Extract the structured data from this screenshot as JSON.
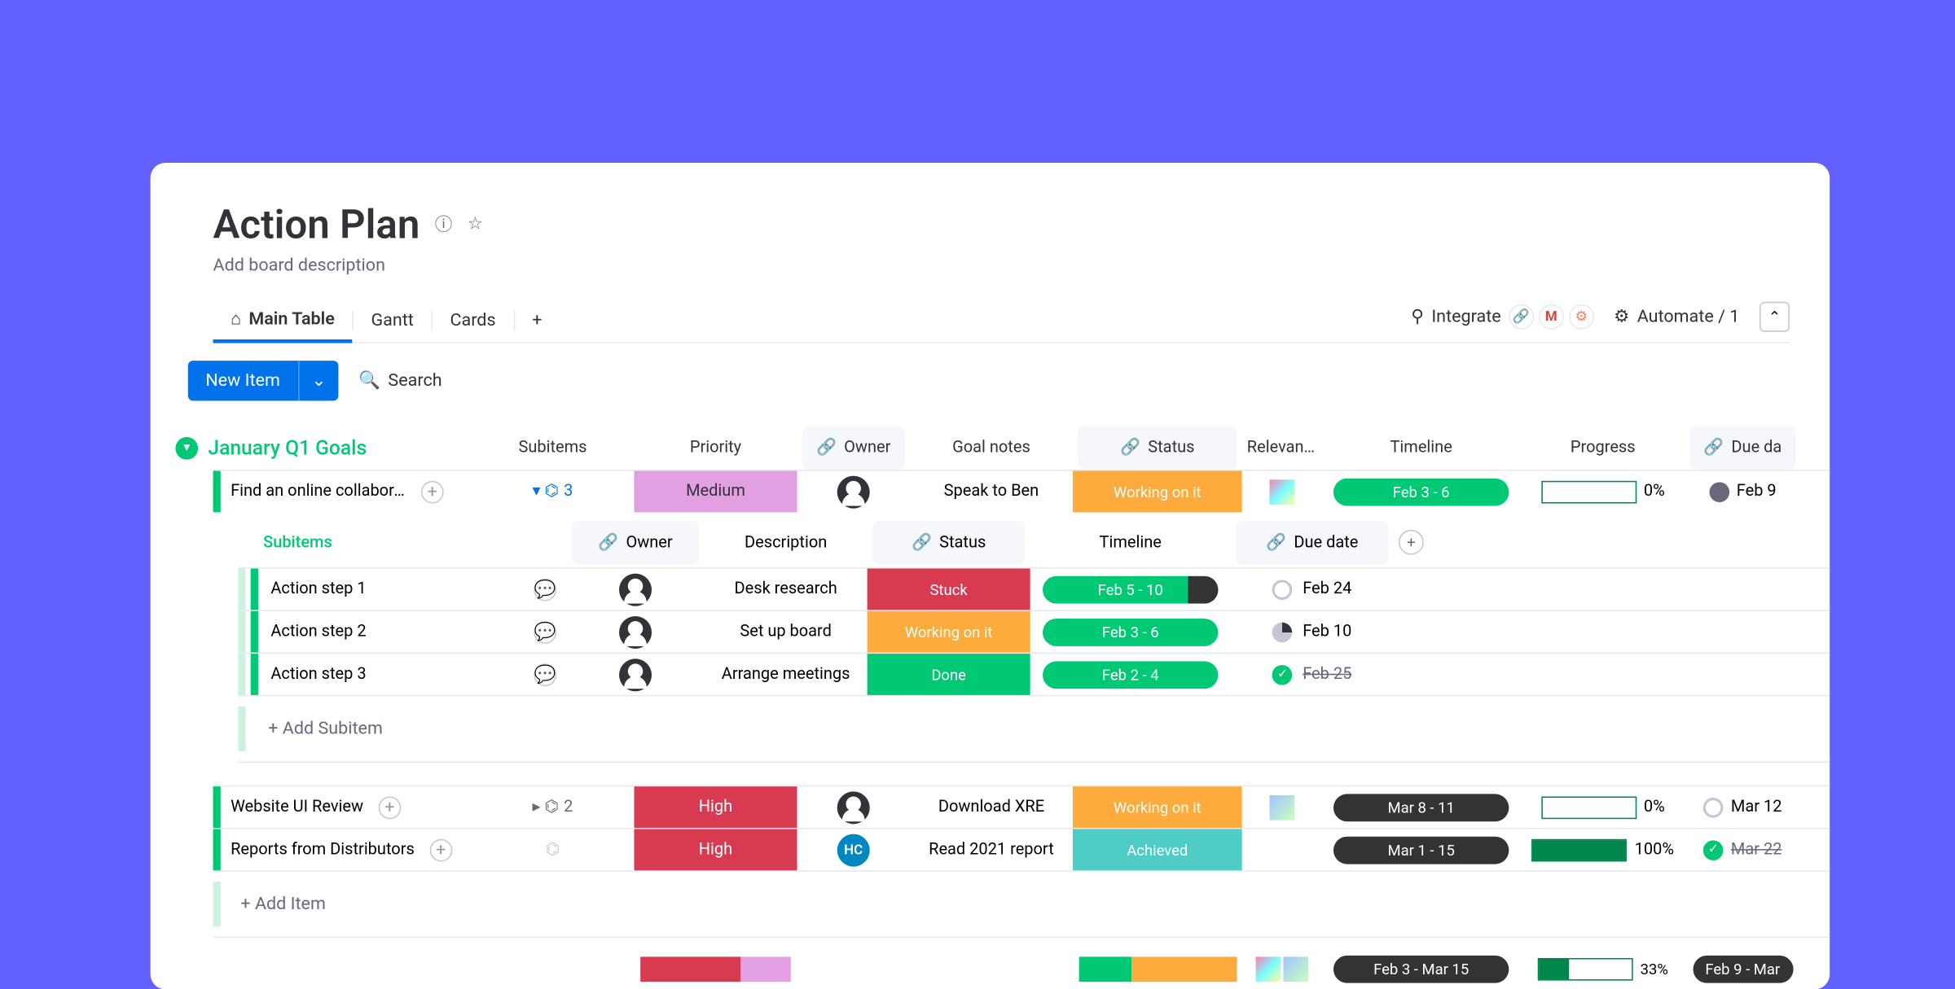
{
  "board": {
    "title": "Action Plan",
    "subtitle": "Add board description"
  },
  "tabs": {
    "main": "Main Table",
    "gantt": "Gantt",
    "cards": "Cards"
  },
  "actions": {
    "integrate": "Integrate",
    "automate": "Automate / 1",
    "new_item": "New Item",
    "search": "Search"
  },
  "group": {
    "name": "January Q1 Goals",
    "columns": {
      "subitems": "Subitems",
      "priority": "Priority",
      "owner": "Owner",
      "goal_notes": "Goal notes",
      "status": "Status",
      "relevant": "Relevant F…",
      "timeline": "Timeline",
      "progress": "Progress",
      "due": "Due da"
    }
  },
  "rows": [
    {
      "name": "Find an online collaborat…",
      "sub_count": "3",
      "priority": "Medium",
      "priority_class": "prio-med",
      "notes": "Speak to Ben",
      "status": "Working on it",
      "status_class": "st-work",
      "timeline": "Feb 3 - 6",
      "progress_pct": "0%",
      "progress_fill": 0,
      "due": "Feb 9"
    },
    {
      "name": "Website UI Review",
      "sub_count": "2",
      "priority": "High",
      "priority_class": "prio-high",
      "notes": "Download XRE",
      "status": "Working on it",
      "status_class": "st-work",
      "timeline": "Mar 8 - 11",
      "progress_pct": "0%",
      "progress_fill": 0,
      "due": "Mar 12"
    },
    {
      "name": "Reports from Distributors",
      "priority": "High",
      "priority_class": "prio-high",
      "owner_initials": "HC",
      "notes": "Read 2021 report",
      "status": "Achieved",
      "status_class": "st-achieved",
      "timeline": "Mar 1 - 15",
      "progress_pct": "100%",
      "progress_fill": 100,
      "due": "Mar 22",
      "due_strike": true,
      "checked": true
    }
  ],
  "subitems_block": {
    "header": "Subitems",
    "cols": {
      "owner": "Owner",
      "desc": "Description",
      "status": "Status",
      "timeline": "Timeline",
      "due": "Due date"
    },
    "rows": [
      {
        "name": "Action step 1",
        "desc": "Desk research",
        "status": "Stuck",
        "status_class": "st-stuck",
        "timeline": "Feb 5 - 10",
        "timeline_partial": true,
        "due": "Feb 24"
      },
      {
        "name": "Action step 2",
        "desc": "Set up board",
        "status": "Working on it",
        "status_class": "st-work",
        "timeline": "Feb 3 - 6",
        "due": "Feb 10",
        "pie": true
      },
      {
        "name": "Action step 3",
        "desc": "Arrange meetings",
        "status": "Done",
        "status_class": "st-done",
        "timeline": "Feb 2 - 4",
        "due": "Feb 25",
        "due_strike": true,
        "checked": true
      }
    ],
    "add": "+ Add Subitem"
  },
  "add_item": "+ Add Item",
  "summary": {
    "timeline": "Feb 3 - Mar 15",
    "progress": "33%",
    "due": "Feb 9 - Mar"
  }
}
